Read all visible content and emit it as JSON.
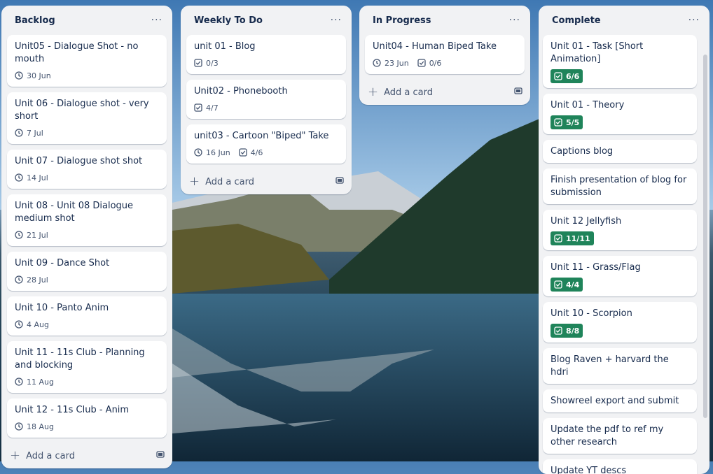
{
  "lists": [
    {
      "title": "Backlog",
      "add_label": "Add a card",
      "cards": [
        {
          "title": "Unit05 - Dialogue Shot - no mouth",
          "date": "30 Jun"
        },
        {
          "title": "Unit 06 - Dialogue shot - very short",
          "date": "7 Jul"
        },
        {
          "title": "Unit 07 - Dialogue shot shot",
          "date": "14 Jul"
        },
        {
          "title": "Unit 08 - Unit 08 Dialogue medium shot",
          "date": "21 Jul"
        },
        {
          "title": "Unit 09 - Dance Shot",
          "date": "28 Jul"
        },
        {
          "title": "Unit 10 - Panto Anim",
          "date": "4 Aug"
        },
        {
          "title": "Unit 11 - 11s Club - Planning and blocking",
          "date": "11 Aug"
        },
        {
          "title": "Unit 12 - 11s Club - Anim",
          "date": "18 Aug"
        }
      ]
    },
    {
      "title": "Weekly To Do",
      "add_label": "Add a card",
      "cards": [
        {
          "title": "unit 01 - Blog",
          "checklist": "0/3"
        },
        {
          "title": "Unit02 - Phonebooth",
          "checklist": "4/7"
        },
        {
          "title": "unit03 - Cartoon \"Biped\" Take",
          "date": "16 Jun",
          "checklist": "4/6"
        }
      ]
    },
    {
      "title": "In Progress",
      "add_label": "Add a card",
      "cards": [
        {
          "title": "Unit04 - Human Biped Take",
          "date": "23 Jun",
          "checklist": "0/6"
        }
      ]
    },
    {
      "title": "Complete",
      "cards": [
        {
          "title": "Unit 01 - Task [Short Animation]",
          "checklist_done": "6/6"
        },
        {
          "title": "Unit 01 - Theory",
          "checklist_done": "5/5"
        },
        {
          "title": "Captions blog"
        },
        {
          "title": "Finish presentation of blog for submission"
        },
        {
          "title": "Unit 12 Jellyfish",
          "checklist_done": "11/11"
        },
        {
          "title": "Unit 11 - Grass/Flag",
          "checklist_done": "4/4"
        },
        {
          "title": "Unit 10 - Scorpion",
          "checklist_done": "8/8"
        },
        {
          "title": "Blog Raven + harvard the hdri"
        },
        {
          "title": "Showreel export and submit"
        },
        {
          "title": "Update the pdf to ref my other research"
        },
        {
          "title": "Update YT descs"
        }
      ]
    }
  ],
  "menu_glyph": "···",
  "add_glyph": "+",
  "colors": {
    "list_bg": "#f1f2f4",
    "done_badge": "#1f845a",
    "text": "#172b4d"
  }
}
